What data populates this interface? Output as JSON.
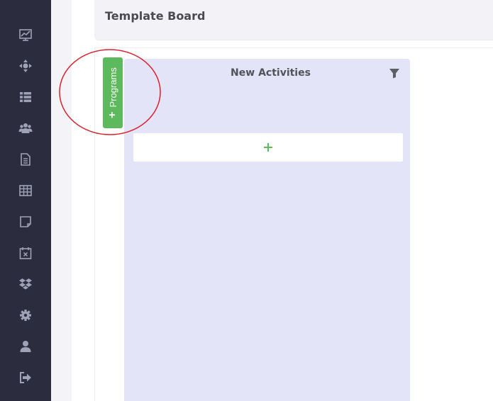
{
  "header": {
    "title": "Template Board"
  },
  "sidebar": {
    "items": [
      {
        "icon": "chart-icon"
      },
      {
        "icon": "arrows-move-icon"
      },
      {
        "icon": "list-icon"
      },
      {
        "icon": "users-icon"
      },
      {
        "icon": "document-icon"
      },
      {
        "icon": "table-icon"
      },
      {
        "icon": "sticky-note-icon"
      },
      {
        "icon": "calendar-x-icon"
      },
      {
        "icon": "dropbox-icon"
      },
      {
        "icon": "gear-icon"
      },
      {
        "icon": "user-icon"
      },
      {
        "icon": "sign-out-icon"
      }
    ]
  },
  "programs_tab": {
    "plus": "+",
    "label": "Programs"
  },
  "column": {
    "title": "New Activities",
    "filter_icon": "filter-icon",
    "add_icon": "plus-icon"
  },
  "colors": {
    "sidebar_bg": "#2b2d3e",
    "sidebar_icon": "#9fa2b6",
    "column_bg": "#e4e4f9",
    "programs_green": "#5cba5c",
    "add_plus_green": "#5cba5c",
    "annotation_red": "#d9202b"
  }
}
